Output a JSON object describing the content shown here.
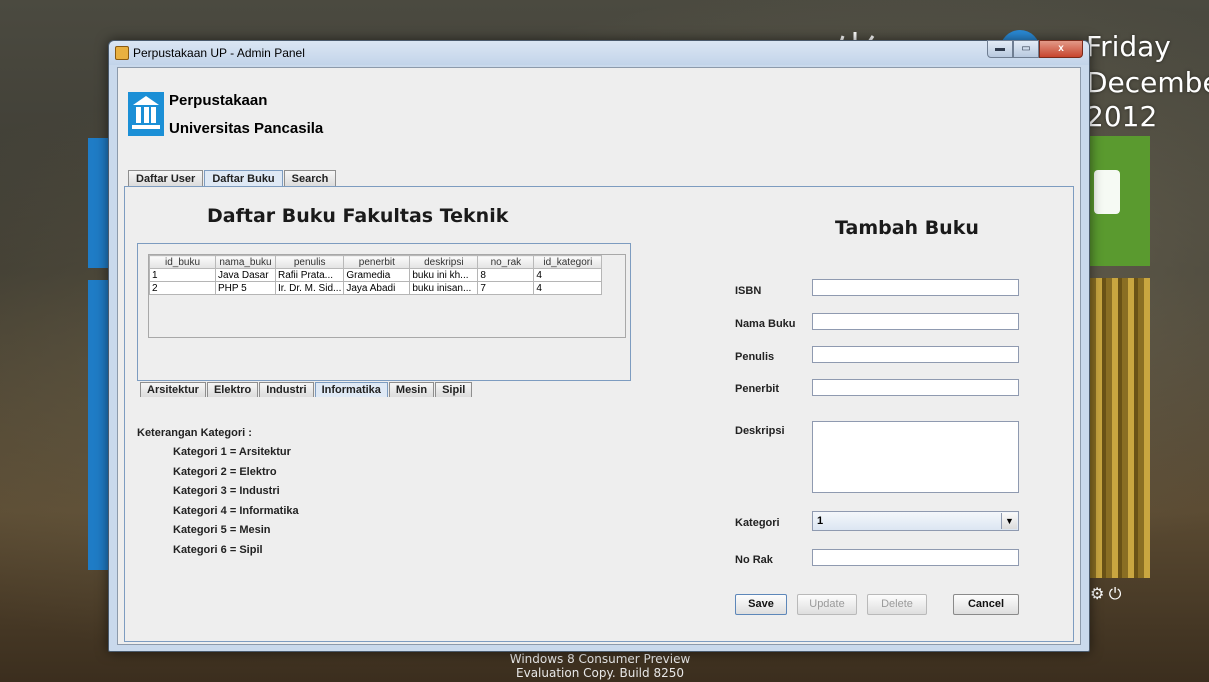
{
  "desktop": {
    "day": "Friday",
    "month": "December",
    "year": "2012",
    "watermark_line1": "Windows 8 Consumer Preview",
    "watermark_line2": "Evaluation Copy. Build 8250"
  },
  "window": {
    "title": "Perpustakaan UP - Admin Panel",
    "min_glyph": "▬",
    "max_glyph": "▭",
    "close_glyph": "x"
  },
  "header": {
    "line1": "Perpustakaan",
    "line2": "Universitas Pancasila"
  },
  "tabs": [
    {
      "label": "Daftar User",
      "active": false
    },
    {
      "label": "Daftar Buku",
      "active": true
    },
    {
      "label": "Search",
      "active": false
    }
  ],
  "list_section": {
    "title": "Daftar Buku Fakultas Teknik",
    "columns": [
      "id_buku",
      "nama_buku",
      "penulis",
      "penerbit",
      "deskripsi",
      "no_rak",
      "id_kategori"
    ],
    "rows": [
      [
        "1",
        "Java Dasar",
        "Rafii Prata...",
        "Gramedia",
        "buku ini kh...",
        "8",
        "4"
      ],
      [
        "2",
        "PHP 5",
        "Ir. Dr. M. Sid...",
        "Jaya Abadi",
        "buku inisan...",
        "7",
        "4"
      ]
    ],
    "category_tabs": [
      {
        "label": "Arsitektur",
        "active": false
      },
      {
        "label": "Elektro",
        "active": false
      },
      {
        "label": "Industri",
        "active": false
      },
      {
        "label": "Informatika",
        "active": true
      },
      {
        "label": "Mesin",
        "active": false
      },
      {
        "label": "Sipil",
        "active": false
      }
    ],
    "legend_title": "Keterangan Kategori :",
    "legend_items": [
      "Kategori 1 = Arsitektur",
      "Kategori 2 = Elektro",
      "Kategori 3 = Industri",
      "Kategori 4 = Informatika",
      "Kategori 5 = Mesin",
      "Kategori 6 = Sipil"
    ]
  },
  "form": {
    "title": "Tambah Buku",
    "isbn_label": "ISBN",
    "isbn_value": "",
    "nama_label": "Nama Buku",
    "nama_value": "",
    "penulis_label": "Penulis",
    "penulis_value": "",
    "penerbit_label": "Penerbit",
    "penerbit_value": "",
    "deskripsi_label": "Deskripsi",
    "deskripsi_value": "",
    "kategori_label": "Kategori",
    "kategori_value": "1",
    "norak_label": "No Rak",
    "norak_value": "",
    "save_label": "Save",
    "update_label": "Update",
    "delete_label": "Delete",
    "cancel_label": "Cancel"
  }
}
